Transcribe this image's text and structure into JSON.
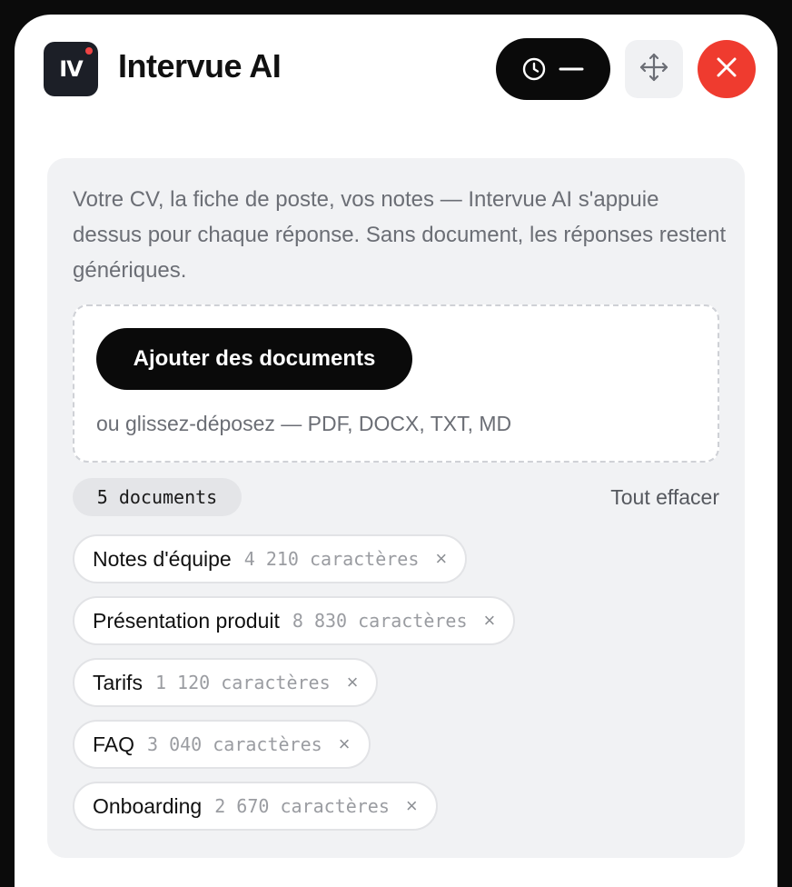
{
  "app": {
    "logo_text": "IV",
    "title": "Intervue AI"
  },
  "toolbar": {
    "timer_icon": "clock-icon",
    "minimize_icon": "minus-icon",
    "move_icon": "move-icon",
    "close_icon": "close-icon",
    "close_color": "#ef3b2f"
  },
  "intro": {
    "text": "Votre CV, la fiche de poste, vos notes — Intervue AI s'appuie dessus pour chaque réponse. Sans document, les réponses restent génériques."
  },
  "upload": {
    "button_label": "Ajouter des documents",
    "hint": "ou glissez-déposez — PDF, DOCX, TXT, MD"
  },
  "documents": {
    "count_label": "5 documents",
    "clear_all_label": "Tout effacer",
    "items": [
      {
        "name": "Notes d'équipe",
        "size": "4 210 caractères",
        "remove": "×"
      },
      {
        "name": "Présentation produit",
        "size": "8 830 caractères",
        "remove": "×"
      },
      {
        "name": "Tarifs",
        "size": "1 120 caractères",
        "remove": "×"
      },
      {
        "name": "FAQ",
        "size": "3 040 caractères",
        "remove": "×"
      },
      {
        "name": "Onboarding",
        "size": "2 670 caractères",
        "remove": "×"
      }
    ]
  }
}
